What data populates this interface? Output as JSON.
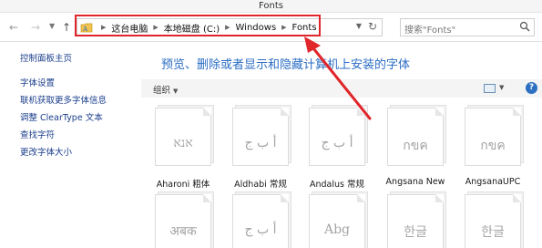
{
  "window": {
    "title": "Fonts"
  },
  "nav": {
    "back_icon": "back-arrow-icon",
    "forward_icon": "forward-arrow-icon",
    "recent_icon": "chevron-down-icon",
    "up_icon": "up-arrow-icon"
  },
  "address": {
    "crumbs": [
      "这台电脑",
      "本地磁盘 (C:)",
      "Windows",
      "Fonts"
    ]
  },
  "search": {
    "placeholder": "搜索\"Fonts\""
  },
  "sidebar": {
    "home": "控制面板主页",
    "items": [
      "字体设置",
      "联机获取更多字体信息",
      "调整 ClearType 文本",
      "查找字符",
      "更改字体大小"
    ]
  },
  "main": {
    "heading": "预览、删除或者显示和隐藏计算机上安装的字体",
    "organize_label": "组织"
  },
  "fonts": [
    {
      "name": "Aharoni 粗体",
      "sample": "אנא"
    },
    {
      "name": "Aldhabi 常规",
      "sample": "أ ب ج"
    },
    {
      "name": "Andalus 常规",
      "sample": "أ ب ج"
    },
    {
      "name": "Angsana New",
      "sample": "กขค"
    },
    {
      "name": "AngsanaUPC",
      "sample": "กขค"
    },
    {
      "name": "",
      "sample": "अबक"
    },
    {
      "name": "",
      "sample": "أ ب ج"
    },
    {
      "name": "",
      "sample": "Abg"
    },
    {
      "name": "",
      "sample": "한글"
    },
    {
      "name": "",
      "sample": "한글"
    }
  ],
  "colors": {
    "highlight": "#e0252b",
    "link": "#1a3e8c",
    "heading": "#2a6cc4"
  }
}
